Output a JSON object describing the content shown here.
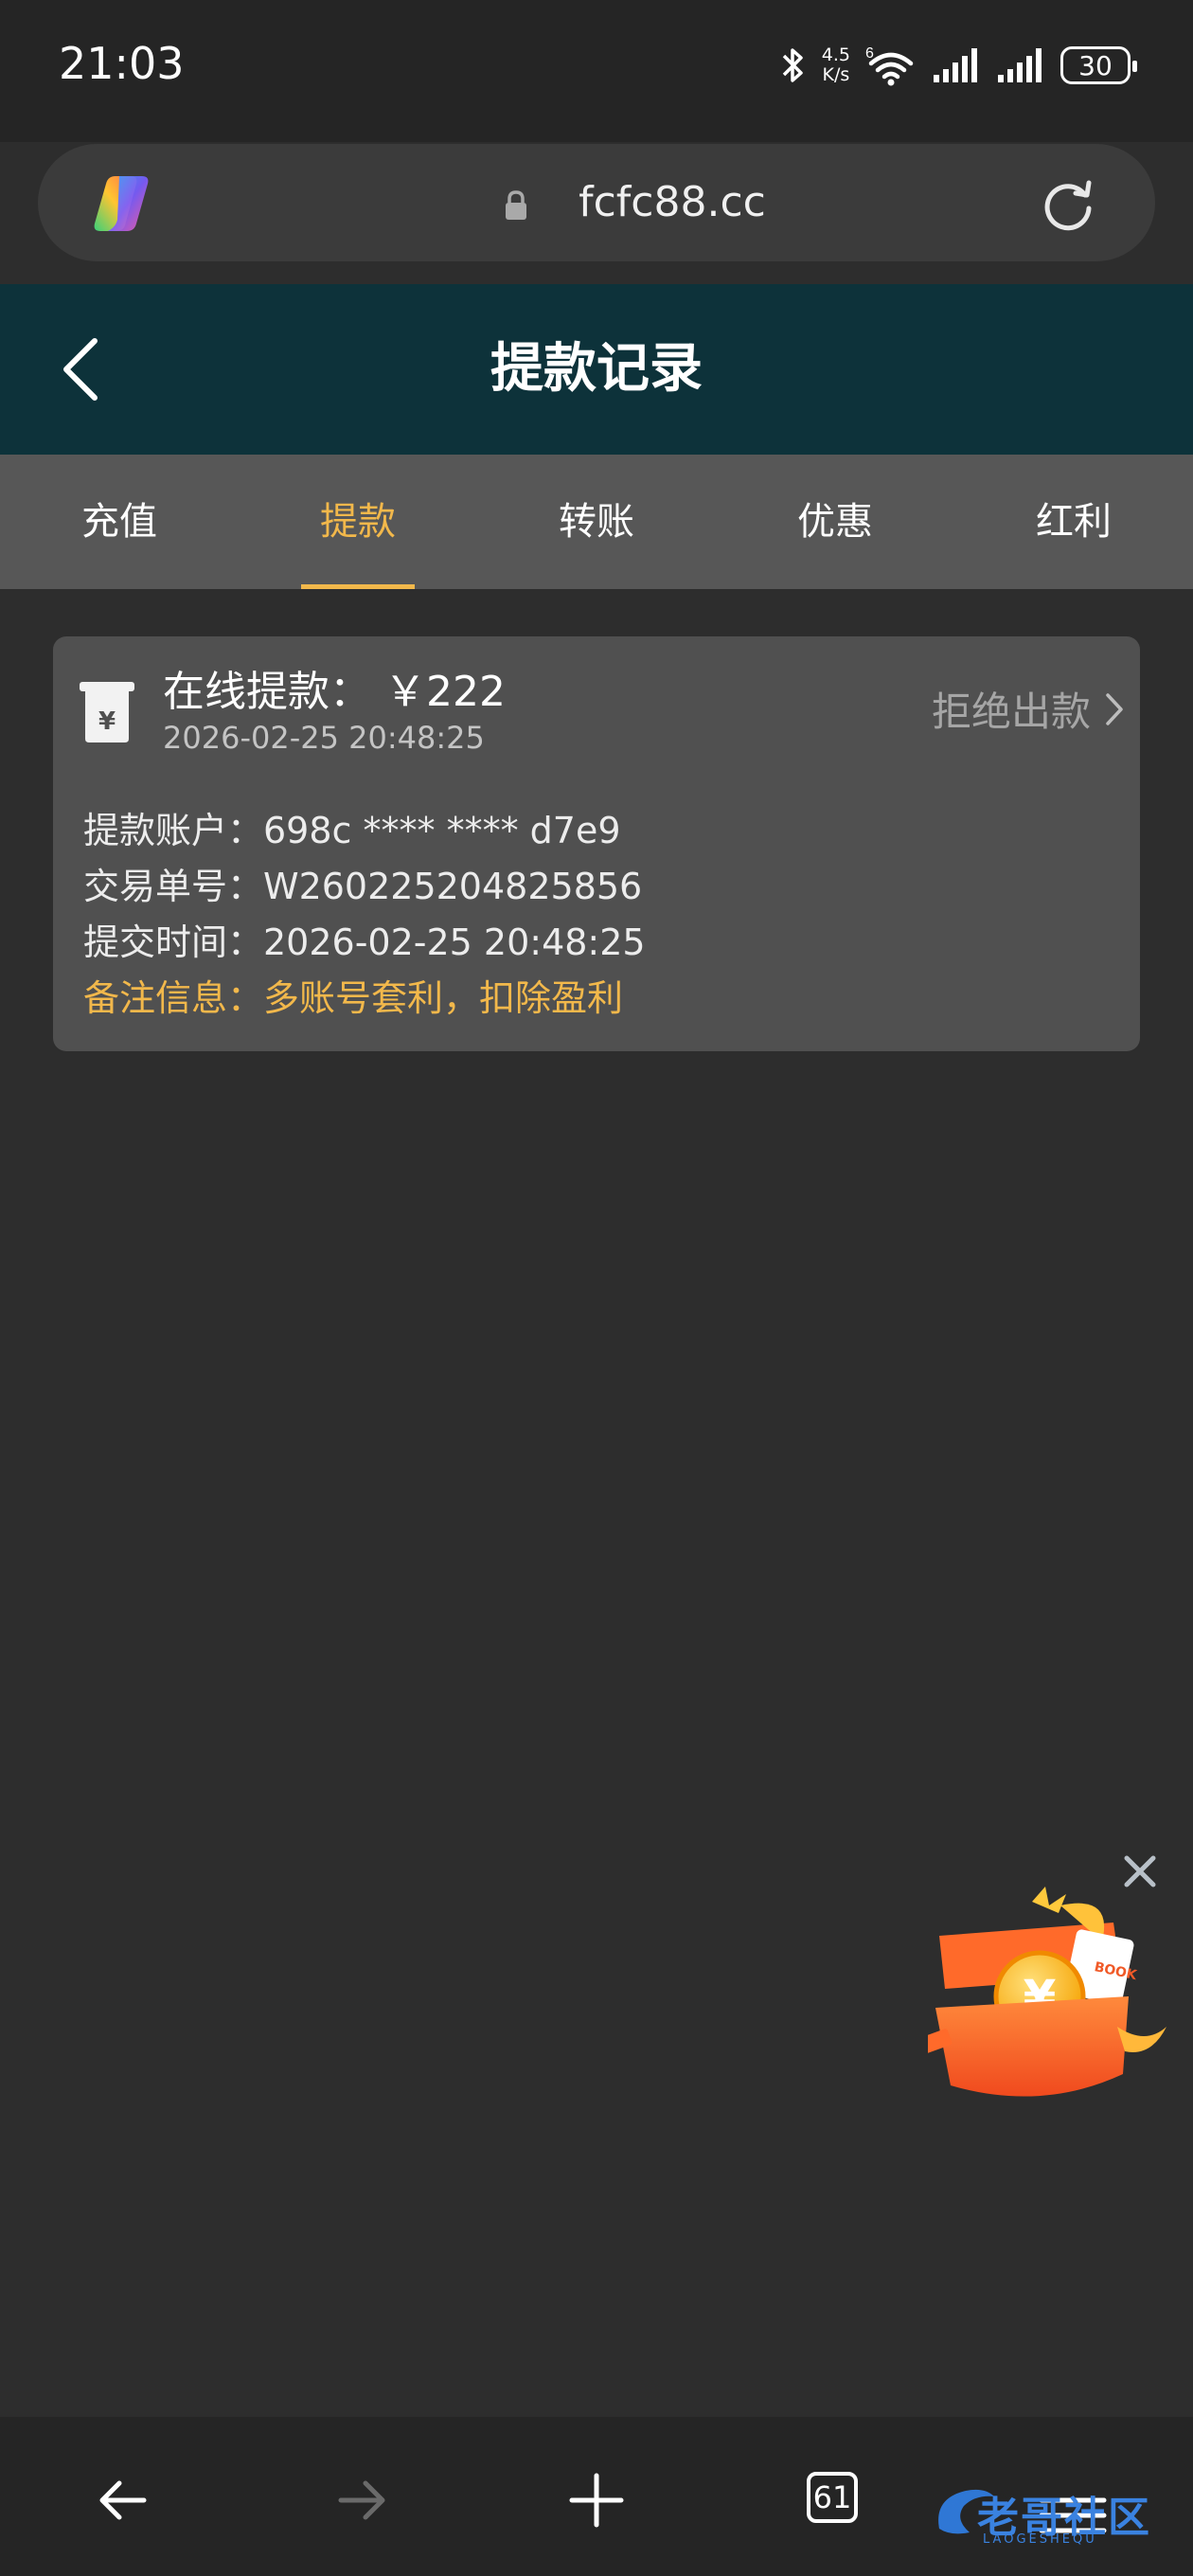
{
  "status_bar": {
    "time": "21:03",
    "net_speed_value": "4.5",
    "net_speed_unit": "K/s",
    "wifi_badge": "6",
    "battery": "30",
    "icons": [
      "bluetooth-icon",
      "wifi-icon",
      "signal-icon",
      "signal-icon",
      "battery-icon"
    ]
  },
  "browser": {
    "url": "fcfc88.cc",
    "tab_count": "61"
  },
  "header": {
    "title": "提款记录"
  },
  "tabs": [
    {
      "label": "充值",
      "active": false
    },
    {
      "label": "提款",
      "active": true
    },
    {
      "label": "转账",
      "active": false
    },
    {
      "label": "优惠",
      "active": false
    },
    {
      "label": "红利",
      "active": false
    }
  ],
  "record": {
    "title": "在线提款： ￥222",
    "datetime": "2026-02-25 20:48:25",
    "status": "拒绝出款",
    "account": "提款账户：698c **** **** d7e9",
    "order_no": "交易单号：W260225204825856",
    "submit_time": "提交时间：2026-02-25 20:48:25",
    "note": "备注信息：多账号套利，扣除盈利"
  },
  "promo": {
    "box_label": "BOOK"
  },
  "watermark": {
    "text": "老哥社区",
    "sub": "LAOGESHEQU"
  },
  "colors": {
    "header_bg": "#0d323a",
    "accent": "#f2b84b",
    "card_bg": "#505050",
    "page_bg": "#2d2d2d"
  }
}
